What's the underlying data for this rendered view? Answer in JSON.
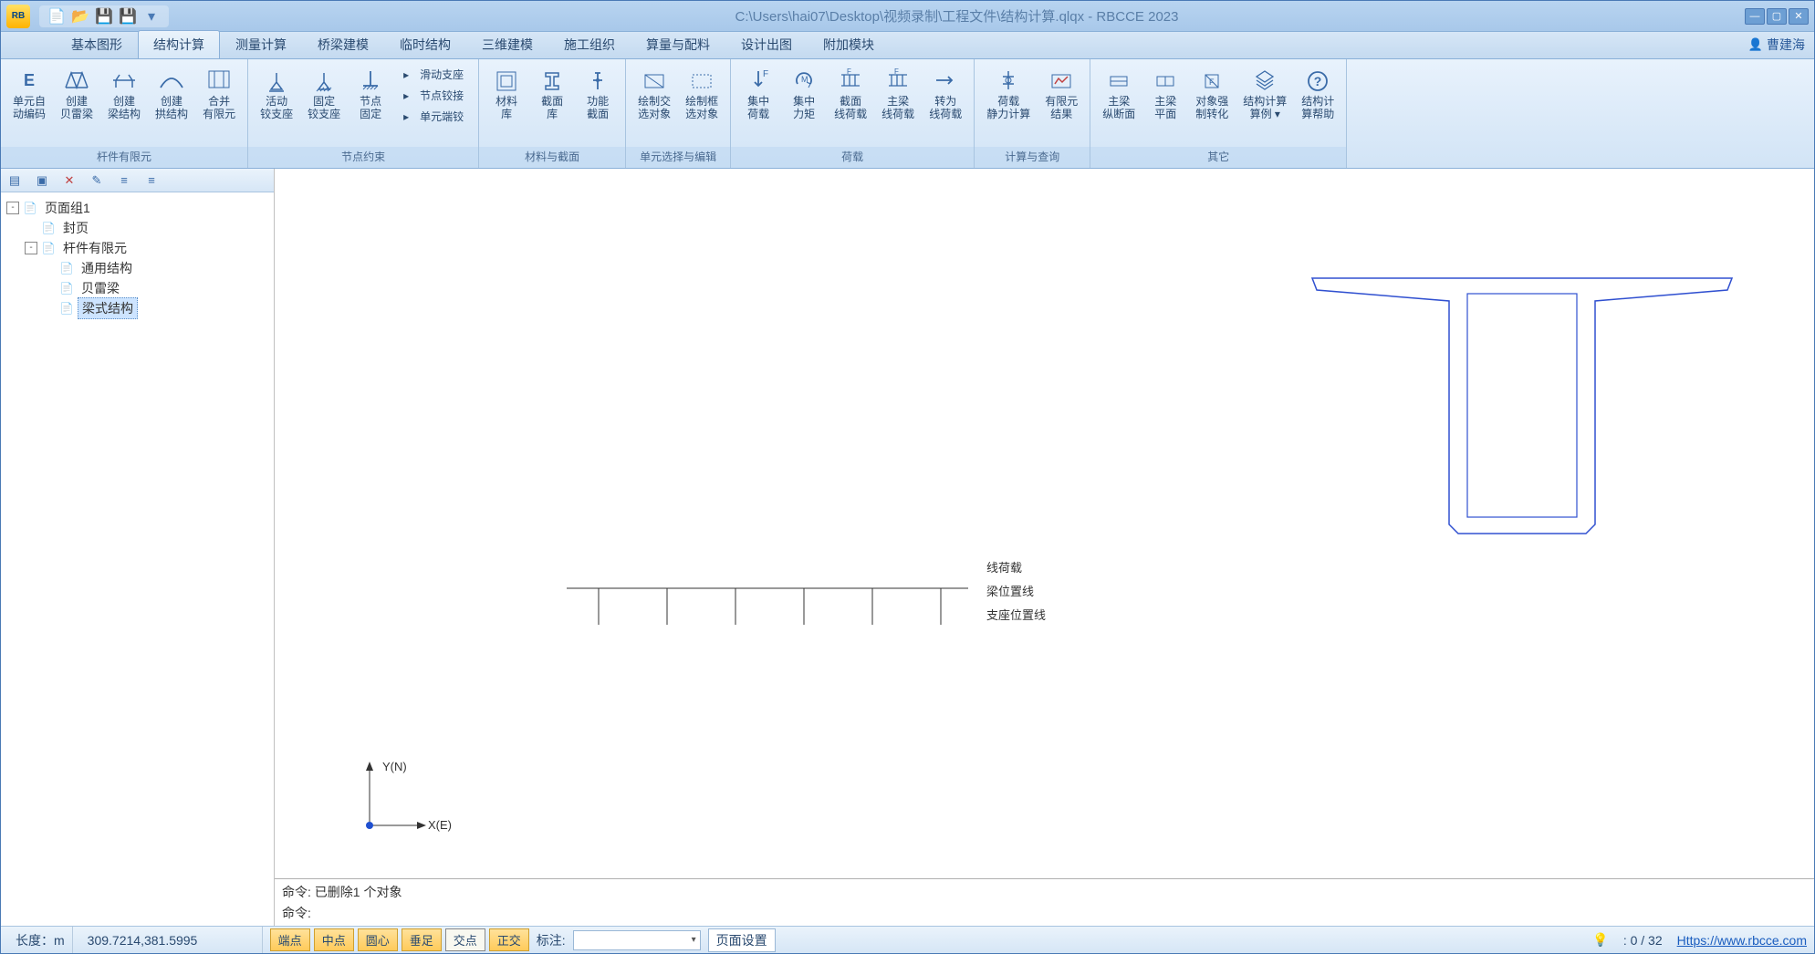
{
  "title": "C:\\Users\\hai07\\Desktop\\视频录制\\工程文件\\结构计算.qlqx - RBCCE 2023",
  "app_icon_text": "RB",
  "user": "曹建海",
  "menu": [
    "基本图形",
    "结构计算",
    "测量计算",
    "桥梁建模",
    "临时结构",
    "三维建模",
    "施工组织",
    "算量与配料",
    "设计出图",
    "附加模块"
  ],
  "active_menu_index": 1,
  "ribbon_groups": [
    {
      "label": "杆件有限元",
      "buttons": [
        {
          "l1": "单元自",
          "l2": "动编码",
          "icon": "E"
        },
        {
          "l1": "创建",
          "l2": "贝雷梁",
          "icon": "truss"
        },
        {
          "l1": "创建",
          "l2": "梁结构",
          "icon": "beam"
        },
        {
          "l1": "创建",
          "l2": "拱结构",
          "icon": "arch"
        },
        {
          "l1": "合并",
          "l2": "有限元",
          "icon": "merge"
        }
      ]
    },
    {
      "label": "节点约束",
      "buttons": [
        {
          "l1": "活动",
          "l2": "铰支座",
          "icon": "sup1"
        },
        {
          "l1": "固定",
          "l2": "铰支座",
          "icon": "sup2"
        },
        {
          "l1": "节点",
          "l2": "固定",
          "icon": "sup3"
        }
      ],
      "small": [
        {
          "icon": "s",
          "label": "滑动支座"
        },
        {
          "icon": "s",
          "label": "节点铰接"
        },
        {
          "icon": "s",
          "label": "单元端铰"
        }
      ]
    },
    {
      "label": "材料与截面",
      "buttons": [
        {
          "l1": "材料",
          "l2": "库",
          "icon": "mat"
        },
        {
          "l1": "截面",
          "l2": "库",
          "icon": "sec"
        },
        {
          "l1": "功能",
          "l2": "截面",
          "icon": "fsec"
        }
      ]
    },
    {
      "label": "单元选择与编辑",
      "buttons": [
        {
          "l1": "绘制交",
          "l2": "选对象",
          "icon": "sel1"
        },
        {
          "l1": "绘制框",
          "l2": "选对象",
          "icon": "sel2"
        }
      ]
    },
    {
      "label": "荷载",
      "buttons": [
        {
          "l1": "集中",
          "l2": "荷载",
          "icon": "f1"
        },
        {
          "l1": "集中",
          "l2": "力矩",
          "icon": "m1"
        },
        {
          "l1": "截面",
          "l2": "线荷载",
          "icon": "q1"
        },
        {
          "l1": "主梁",
          "l2": "线荷载",
          "icon": "q2"
        },
        {
          "l1": "转为",
          "l2": "线荷载",
          "icon": "q3"
        }
      ]
    },
    {
      "label": "计算与查询",
      "buttons": [
        {
          "l1": "荷载",
          "l2": "静力计算",
          "icon": "calc"
        },
        {
          "l1": "有限元",
          "l2": "结果",
          "icon": "res"
        }
      ]
    },
    {
      "label": "其它",
      "buttons": [
        {
          "l1": "主梁",
          "l2": "纵断面",
          "icon": "v1"
        },
        {
          "l1": "主梁",
          "l2": "平面",
          "icon": "v2"
        },
        {
          "l1": "对象强",
          "l2": "制转化",
          "icon": "cv"
        },
        {
          "l1": "结构计算",
          "l2": "算例 ▾",
          "icon": "ex"
        },
        {
          "l1": "结构计",
          "l2": "算帮助",
          "icon": "help"
        }
      ]
    }
  ],
  "tree": [
    {
      "indent": 0,
      "toggle": "-",
      "icon": "📄",
      "label": "页面组1"
    },
    {
      "indent": 1,
      "toggle": "",
      "icon": "📄",
      "label": "封页"
    },
    {
      "indent": 1,
      "toggle": "-",
      "icon": "📄",
      "label": "杆件有限元"
    },
    {
      "indent": 2,
      "toggle": "",
      "icon": "📄",
      "label": "通用结构"
    },
    {
      "indent": 2,
      "toggle": "",
      "icon": "📄",
      "label": "贝雷梁"
    },
    {
      "indent": 2,
      "toggle": "",
      "icon": "📄",
      "label": "梁式结构",
      "selected": true
    }
  ],
  "canvas_labels": {
    "line_load": "线荷载",
    "beam_line": "梁位置线",
    "support_line": "支座位置线",
    "y": "Y(N)",
    "x": "X(E)"
  },
  "command": {
    "log": "命令: 已删除1 个对象",
    "prompt": "命令:"
  },
  "status": {
    "unit_label": "长度：m",
    "coords": "309.7214,381.5995",
    "snaps": [
      {
        "label": "端点",
        "active": true
      },
      {
        "label": "中点",
        "active": true
      },
      {
        "label": "圆心",
        "active": true
      },
      {
        "label": "垂足",
        "active": true
      },
      {
        "label": "交点",
        "active": false
      },
      {
        "label": "正交",
        "active": true
      }
    ],
    "annot_label": "标注:",
    "page_settings": "页面设置",
    "counter": "0 / 32",
    "url": "Https://www.rbcce.com"
  }
}
